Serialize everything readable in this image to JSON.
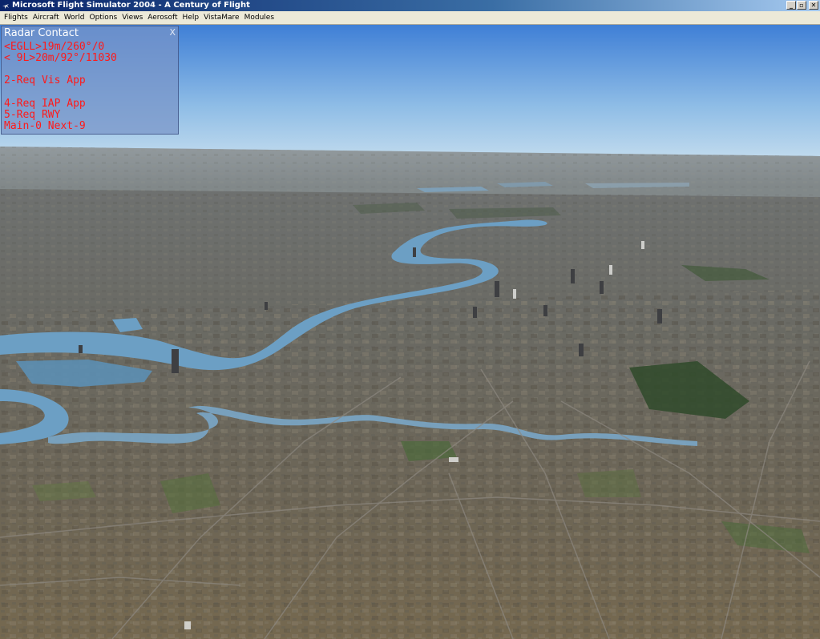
{
  "window": {
    "title": "Microsoft Flight Simulator 2004 - A Century of Flight",
    "buttons": {
      "minimize": "_",
      "restore": "▫",
      "close": "✕"
    }
  },
  "menu": [
    "Flights",
    "Aircraft",
    "World",
    "Options",
    "Views",
    "Aerosoft",
    "Help",
    "VistaMare",
    "Modules"
  ],
  "radar_contact": {
    "title": "Radar Contact",
    "close": "X",
    "lines": [
      "<EGLL>19m/260°/0",
      "< 9L>20m/92°/11030",
      "",
      "2-Req Vis App",
      "",
      "4-Req IAP App",
      "5-Req RWY",
      "Main-0 Next-9"
    ]
  },
  "colors": {
    "text_red": "#ff1a1a",
    "panel_blue": "#7894c8",
    "sky_top": "#3f7fd6",
    "sky_horizon": "#c3dcee",
    "river": "#6c9fc4"
  }
}
